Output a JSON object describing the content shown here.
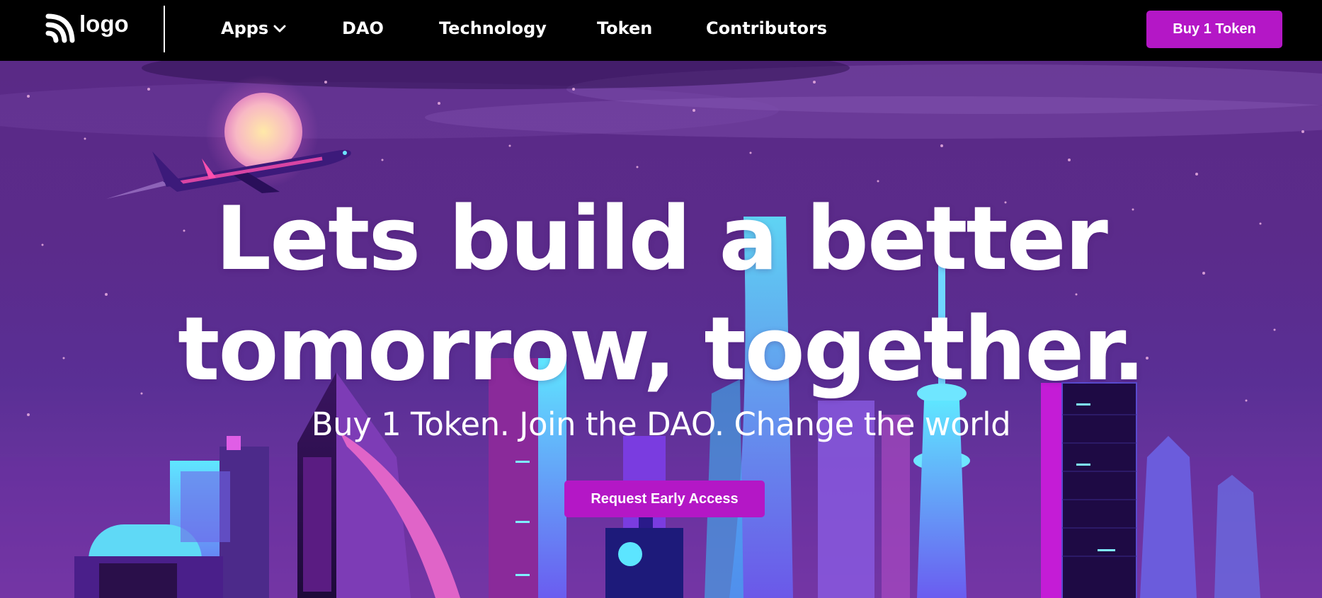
{
  "nav": {
    "logo_text": "logo",
    "items": [
      {
        "label": "Apps",
        "has_dropdown": true
      },
      {
        "label": "DAO"
      },
      {
        "label": "Technology"
      },
      {
        "label": "Token"
      },
      {
        "label": "Contributors"
      }
    ],
    "buy_button_label": "Buy 1 Token"
  },
  "hero": {
    "headline_line1": "Lets build a better",
    "headline_line2": "tomorrow, together.",
    "subheadline": "Buy 1 Token. Join the DAO. Change the world",
    "cta_label": "Request Early Access",
    "illustration": "neon city skyline at night with airplane and moon"
  },
  "colors": {
    "nav_background": "#000000",
    "accent": "#b417c6",
    "hero_purple": "#5a2a86",
    "neon_cyan": "#37d6f5",
    "neon_pink": "#e24ad8"
  }
}
